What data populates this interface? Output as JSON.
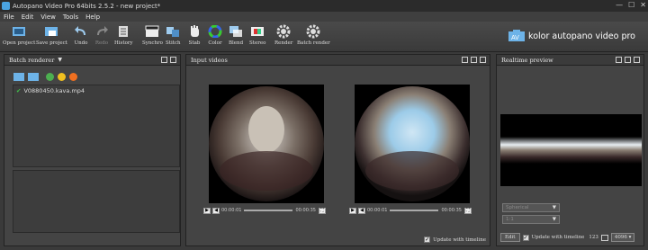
{
  "window": {
    "title": "Autopano Video Pro 64bits 2.5.2 - new project*",
    "min": "—",
    "max": "☐",
    "close": "✕"
  },
  "menu": [
    "File",
    "Edit",
    "View",
    "Tools",
    "Help"
  ],
  "toolbar": {
    "open": "Open project",
    "save": "Save project",
    "undo": "Undo",
    "redo": "Redo",
    "history": "History",
    "synchro": "Synchro",
    "stitch": "Stitch",
    "stab": "Stab",
    "color": "Color",
    "blend": "Blend",
    "stereo": "Stereo",
    "render": "Render",
    "batch": "Batch render"
  },
  "brand": "kolor autopano video pro",
  "batch": {
    "title": "Batch renderer",
    "dropdown": "▼",
    "file": "V0880450.kava.mp4"
  },
  "input": {
    "title": "Input videos",
    "videos": [
      {
        "start": "00:00:01",
        "end": "00:00:35"
      },
      {
        "start": "00:00:01",
        "end": "00:00:35"
      }
    ],
    "update": "Update with timeline"
  },
  "preview": {
    "title": "Realtime preview",
    "projection": "Spherical",
    "option2": "1:1",
    "edit": "Edit",
    "update": "Update with timeline",
    "zoom": "123",
    "resolution": "4096"
  }
}
